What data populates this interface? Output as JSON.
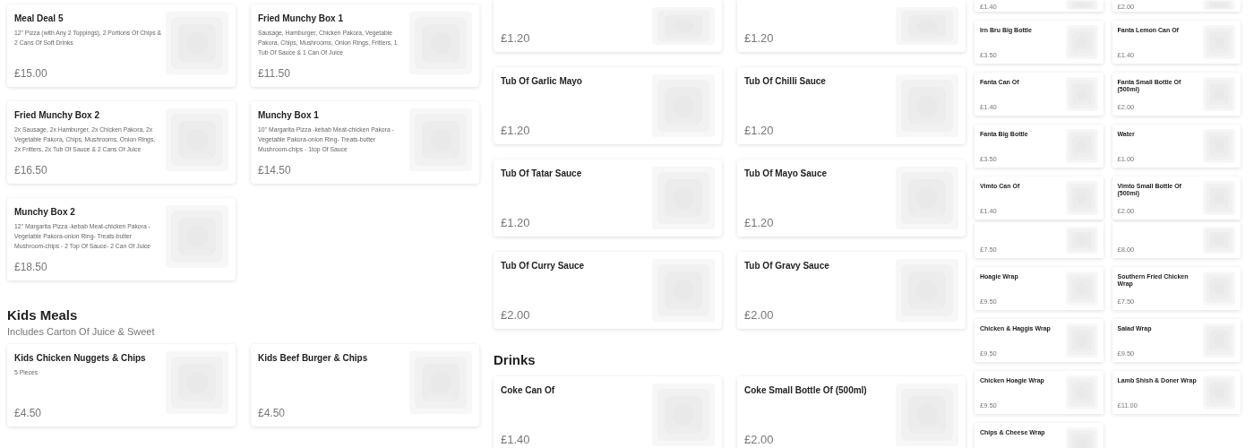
{
  "panels": [
    {
      "sections": [
        {
          "cards": [
            {
              "name": "Meal Deal 5",
              "description": "12\" Pizza (with Any 2 Toppings), 2 Portions Of Chips & 2 Cans Of Soft Drinks",
              "price": "£15.00"
            },
            {
              "name": "Fried Munchy Box 1",
              "description": "Sausage, Hamburger, Chicken Pakora, Vegetable Pakora, Chips, Mushrooms, Onion Rings, Fritters, 1 Tub Of Sauce & 1 Can Of Juice",
              "price": "£11.50"
            },
            {
              "name": "Fried Munchy Box 2",
              "description": "2x Sausage, 2x Hamburger, 2x Chicken Pakora, 2x Vegetable Pakora, Chips, Mushrooms, Onion Rings, 2x Fritters, 2x Tub Of Sauce & 2 Cans Of Juice",
              "price": "£16.50"
            },
            {
              "name": "Munchy Box 1",
              "description": "10'' Margarita Pizza -kebab Meat-chicken Pakora -Vegetable Pakora-onion Ring- Treats-butter Mushroom-chips - 1top Of Sauce",
              "price": "£14.50"
            },
            {
              "name": "Munchy Box 2",
              "description": "12'' Margarita Pizza -kebab Meat-chicken Pakora -Vegetable Pakora-onion Ring- Treats-butter Mushroom-chips - 2 Top Of Sauce- 2 Can Of Juice",
              "price": "£18.50"
            }
          ]
        },
        {
          "title": "Kids Meals",
          "subtitle": "Includes Carton Of Juice & Sweet",
          "cards": [
            {
              "name": "Kids Chicken Nuggets & Chips",
              "description": "5 Pieces",
              "price": "£4.50"
            },
            {
              "name": "Kids Beef Burger & Chips",
              "price": "£4.50"
            }
          ]
        }
      ]
    },
    {
      "sections": [
        {
          "cards": [
            {
              "price": "£1.20"
            },
            {
              "price": "£1.20"
            },
            {
              "name": "Tub Of Garlic Mayo",
              "price": "£1.20"
            },
            {
              "name": "Tub Of Chilli Sauce",
              "price": "£1.20"
            },
            {
              "name": "Tub Of Tatar Sauce",
              "price": "£1.20"
            },
            {
              "name": "Tub Of Mayo Sauce",
              "price": "£1.20"
            },
            {
              "name": "Tub Of Curry Sauce",
              "price": "£2.00"
            },
            {
              "name": "Tub Of Gravy Sauce",
              "price": "£2.00"
            }
          ]
        },
        {
          "title": "Drinks",
          "cards": [
            {
              "name": "Coke Can Of",
              "price": "£1.40"
            },
            {
              "name": "Coke Small Bottle Of (500ml)",
              "price": "£2.00"
            }
          ]
        }
      ]
    },
    {
      "sections": [
        {
          "cards": [
            {
              "price": "£1.40"
            },
            {
              "price": "£2.00"
            },
            {
              "name": "Irn Bru Big Bottle",
              "price": "£3.50"
            },
            {
              "name": "Fanta Lemon Can Of",
              "price": "£1.40"
            },
            {
              "name": "Fanta Can Of",
              "price": "£1.40"
            },
            {
              "name": "Fanta Small Bottle Of (500ml)",
              "price": "£2.00"
            },
            {
              "name": "Fanta Big Bottle",
              "price": "£3.50"
            },
            {
              "name": "Water",
              "price": "£1.00"
            },
            {
              "name": "Vimto Can Of",
              "price": "£1.40"
            },
            {
              "name": "Vimto Small Bottle Of (500ml)",
              "price": "£2.00"
            }
          ]
        },
        {
          "cards": [
            {
              "price": "£7.50"
            },
            {
              "price": "£8.00"
            },
            {
              "name": "Hoagie Wrap",
              "price": "£9.50"
            },
            {
              "name": "Southern Fried Chicken Wrap",
              "price": "£7.50"
            },
            {
              "name": "Chicken & Haggis Wrap",
              "price": "£9.50"
            },
            {
              "name": "Salad Wrap",
              "price": "£9.50"
            },
            {
              "name": "Chicken Hoagie Wrap",
              "price": "£9.50"
            },
            {
              "name": "Lamb Shish & Doner Wrap",
              "price": "£11.00"
            },
            {
              "name": "Chips & Cheese Wrap"
            }
          ]
        }
      ]
    }
  ]
}
